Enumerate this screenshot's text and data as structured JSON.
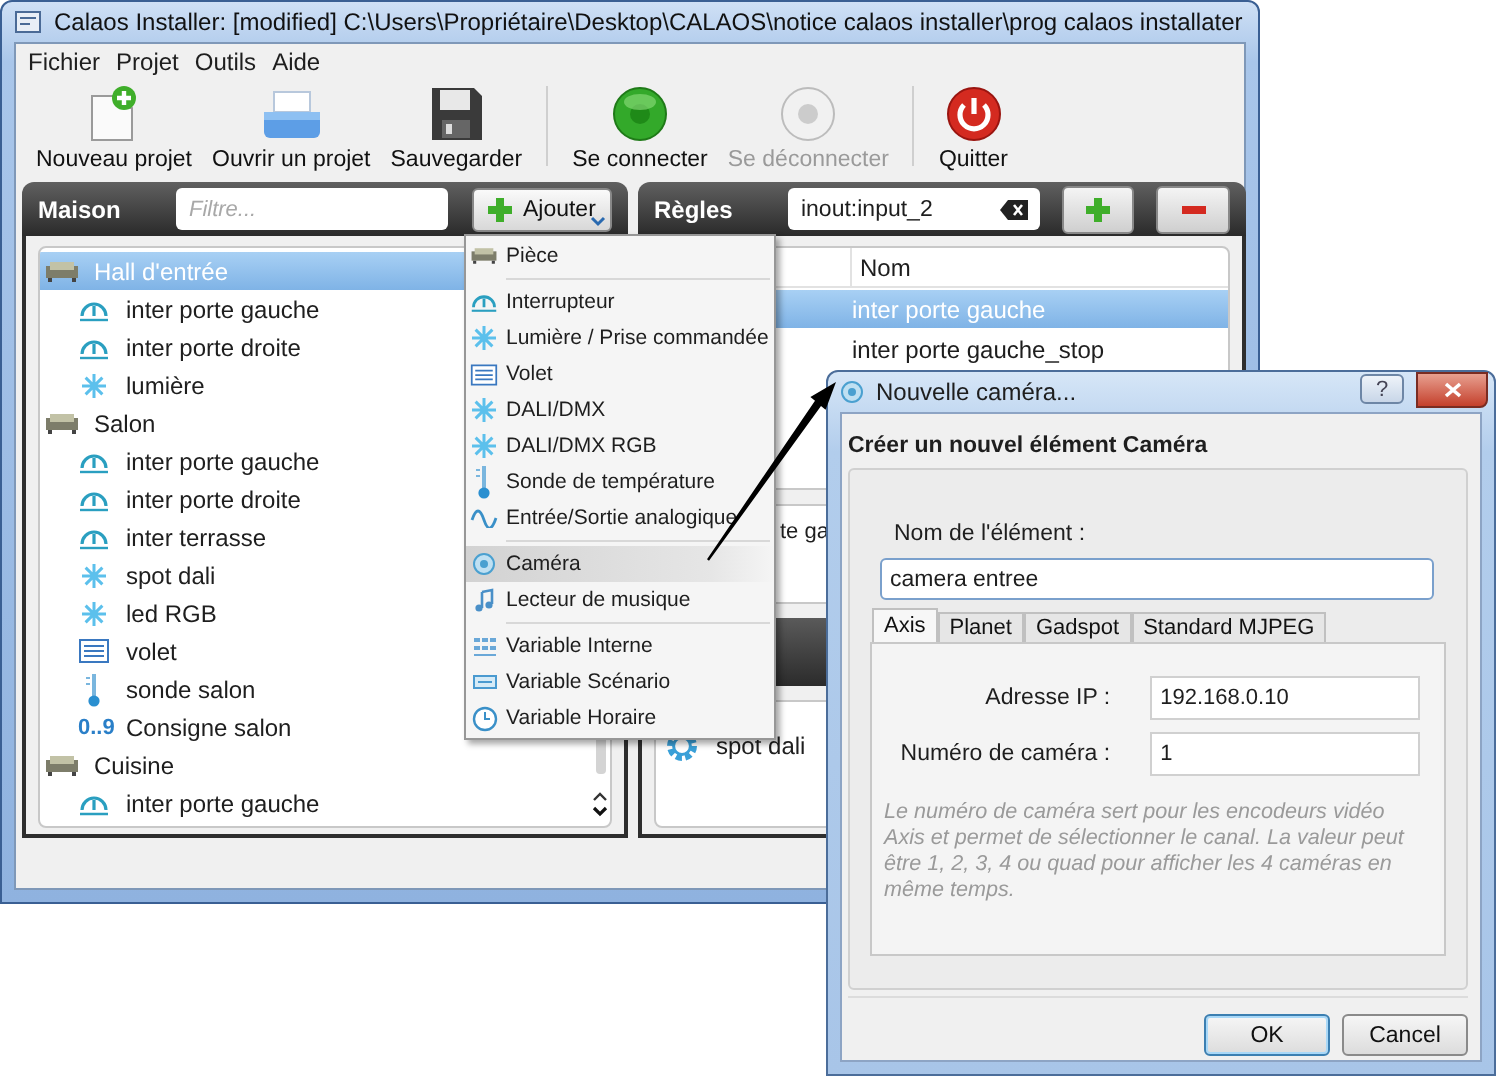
{
  "window": {
    "title": "Calaos Installer: [modified] C:\\Users\\Propriétaire\\Desktop\\CALAOS\\notice calaos installer\\prog calaos installater"
  },
  "menubar": [
    "Fichier",
    "Projet",
    "Outils",
    "Aide"
  ],
  "toolbar": [
    [
      {
        "label": "Nouveau projet",
        "kind": "new",
        "disabled": false
      },
      {
        "label": "Ouvrir un projet",
        "kind": "open",
        "disabled": false
      },
      {
        "label": "Sauvegarder",
        "kind": "save",
        "disabled": false
      }
    ],
    [
      {
        "label": "Se connecter",
        "kind": "connect",
        "disabled": false
      },
      {
        "label": "Se déconnecter",
        "kind": "disconnect",
        "disabled": true
      }
    ],
    [
      {
        "label": "Quitter",
        "kind": "quit",
        "disabled": false
      }
    ]
  ],
  "house_panel": {
    "title": "Maison",
    "filter": {
      "placeholder": "Filtre..."
    },
    "add_button": "Ajouter",
    "tree": [
      {
        "label": "Hall d'entrée",
        "kind": "room",
        "selected": true,
        "children": [
          {
            "label": "inter porte gauche",
            "kind": "switch",
            "selected": false
          },
          {
            "label": "inter porte droite",
            "kind": "switch",
            "selected": false
          },
          {
            "label": "lumière",
            "kind": "light",
            "selected": false
          }
        ]
      },
      {
        "label": "Salon",
        "kind": "room",
        "selected": false,
        "children": [
          {
            "label": "inter porte gauche",
            "kind": "switch",
            "selected": false
          },
          {
            "label": "inter porte droite",
            "kind": "switch",
            "selected": false
          },
          {
            "label": "inter terrasse",
            "kind": "switch",
            "selected": false
          },
          {
            "label": "spot dali",
            "kind": "light",
            "selected": false
          },
          {
            "label": "led RGB",
            "kind": "light",
            "selected": false
          },
          {
            "label": "volet",
            "kind": "shutter",
            "selected": false
          },
          {
            "label": "sonde salon",
            "kind": "temp",
            "selected": false
          },
          {
            "label": "Consigne salon",
            "kind": "number",
            "prefix": "0..9",
            "selected": false
          }
        ]
      },
      {
        "label": "Cuisine",
        "kind": "room",
        "selected": false,
        "children": [
          {
            "label": "inter porte gauche",
            "kind": "switch",
            "selected": false
          }
        ]
      }
    ]
  },
  "rules_panel": {
    "title": "Règles",
    "search": {
      "value": "inout:input_2"
    },
    "table": {
      "columns": [
        "Nom"
      ],
      "rows": [
        {
          "cells": [
            "inter porte gauche"
          ],
          "selected": true
        },
        {
          "cells": [
            "inter porte gauche_stop"
          ],
          "selected": false
        }
      ]
    },
    "partial_rows": [
      "te ga"
    ],
    "action_list": [
      {
        "label": "spot dali",
        "kind": "gear"
      }
    ]
  },
  "add_menu": {
    "groups": [
      [
        {
          "label": "Pièce",
          "kind": "room",
          "selected": false
        }
      ],
      [
        {
          "label": "Interrupteur",
          "kind": "switch",
          "selected": false
        },
        {
          "label": "Lumière / Prise commandée",
          "kind": "light",
          "selected": false
        },
        {
          "label": "Volet",
          "kind": "shutter",
          "selected": false
        },
        {
          "label": "DALI/DMX",
          "kind": "light",
          "selected": false
        },
        {
          "label": "DALI/DMX RGB",
          "kind": "light",
          "selected": false
        },
        {
          "label": "Sonde de température",
          "kind": "temp",
          "selected": false
        },
        {
          "label": "Entrée/Sortie analogique",
          "kind": "wave",
          "selected": false
        }
      ],
      [
        {
          "label": "Caméra",
          "kind": "camera",
          "selected": true
        },
        {
          "label": "Lecteur de musique",
          "kind": "music",
          "selected": false
        }
      ],
      [
        {
          "label": "Variable Interne",
          "kind": "grid",
          "selected": false
        },
        {
          "label": "Variable Scénario",
          "kind": "scenario",
          "selected": false
        },
        {
          "label": "Variable Horaire",
          "kind": "clock",
          "selected": false
        }
      ]
    ]
  },
  "dialog": {
    "title": "Nouvelle caméra...",
    "help_button": "?",
    "heading": "Créer un nouvel élément Caméra",
    "name_label": "Nom de l'élément :",
    "name_value": "camera entree",
    "tabs": [
      {
        "label": "Axis",
        "selected": true
      },
      {
        "label": "Planet",
        "selected": false
      },
      {
        "label": "Gadspot",
        "selected": false
      },
      {
        "label": "Standard MJPEG",
        "selected": false
      }
    ],
    "fields": [
      {
        "label": "Adresse IP :",
        "value": "192.168.0.10"
      },
      {
        "label": "Numéro de caméra :",
        "value": "1"
      }
    ],
    "note": "Le numéro de caméra sert pour les encodeurs vidéo Axis et permet de sélectionner le canal. La valeur peut être 1, 2, 3, 4 ou quad pour afficher les 4 caméras en même temps.",
    "buttons": [
      {
        "label": "OK",
        "default": true
      },
      {
        "label": "Cancel",
        "default": false
      }
    ]
  }
}
